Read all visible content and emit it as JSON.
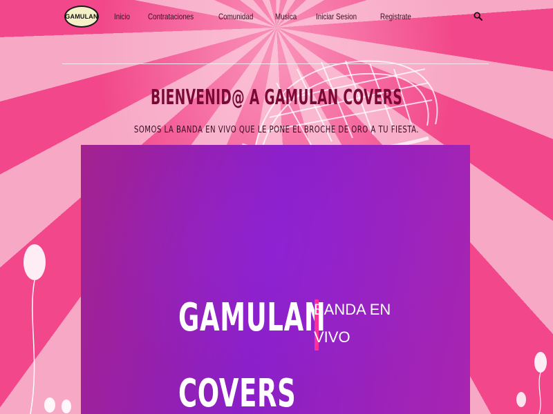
{
  "brand": {
    "logo_text": "GAMULAN"
  },
  "nav": {
    "items": [
      {
        "label": "Inicio"
      },
      {
        "label": "Contrataciones"
      },
      {
        "label": "Comunidad"
      },
      {
        "label": "Musica"
      },
      {
        "label": "Iniciar Sesion"
      },
      {
        "label": "Registrate"
      }
    ],
    "search_icon": "search-icon"
  },
  "hero": {
    "title": "BIENVENID@ A GAMULAN COVERS",
    "subtitle": "SOMOS LA BANDA EN VIVO QUE LE PONE EL BROCHE DE ORO A TU FIESTA."
  },
  "video": {
    "line1": "GAMULAN",
    "line2": "COVERS",
    "tag_line1": "BANDA EN",
    "tag_line2": "VIVO"
  },
  "colors": {
    "accent_pink": "#f2478a",
    "title_color": "#7a0a35",
    "video_purple": "#8a1fc8",
    "cursor_pink": "#ff2e9a"
  }
}
